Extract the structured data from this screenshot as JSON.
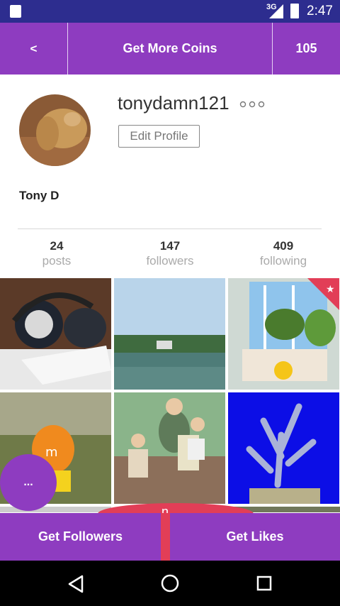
{
  "status_bar": {
    "network": "3G",
    "time": "2:47"
  },
  "top_bar": {
    "back_label": "<",
    "title": "Get More Coins",
    "coins": "105"
  },
  "profile": {
    "username": "tonydamn121",
    "more_label": "ooo",
    "edit_label": "Edit Profile",
    "full_name": "Tony D"
  },
  "stats": [
    {
      "number": "24",
      "label": "posts"
    },
    {
      "number": "147",
      "label": "followers"
    },
    {
      "number": "409",
      "label": "following"
    }
  ],
  "fab_label": "...",
  "partial_text": "n",
  "bottom": {
    "followers_label": "Get Followers",
    "likes_label": "Get Likes"
  },
  "colors": {
    "accent": "#8e3cc0",
    "status": "#2d2d8f",
    "red": "#e23e57"
  },
  "icons": {
    "back": "back-triangle-icon",
    "home": "home-circle-icon",
    "recents": "recents-square-icon"
  }
}
